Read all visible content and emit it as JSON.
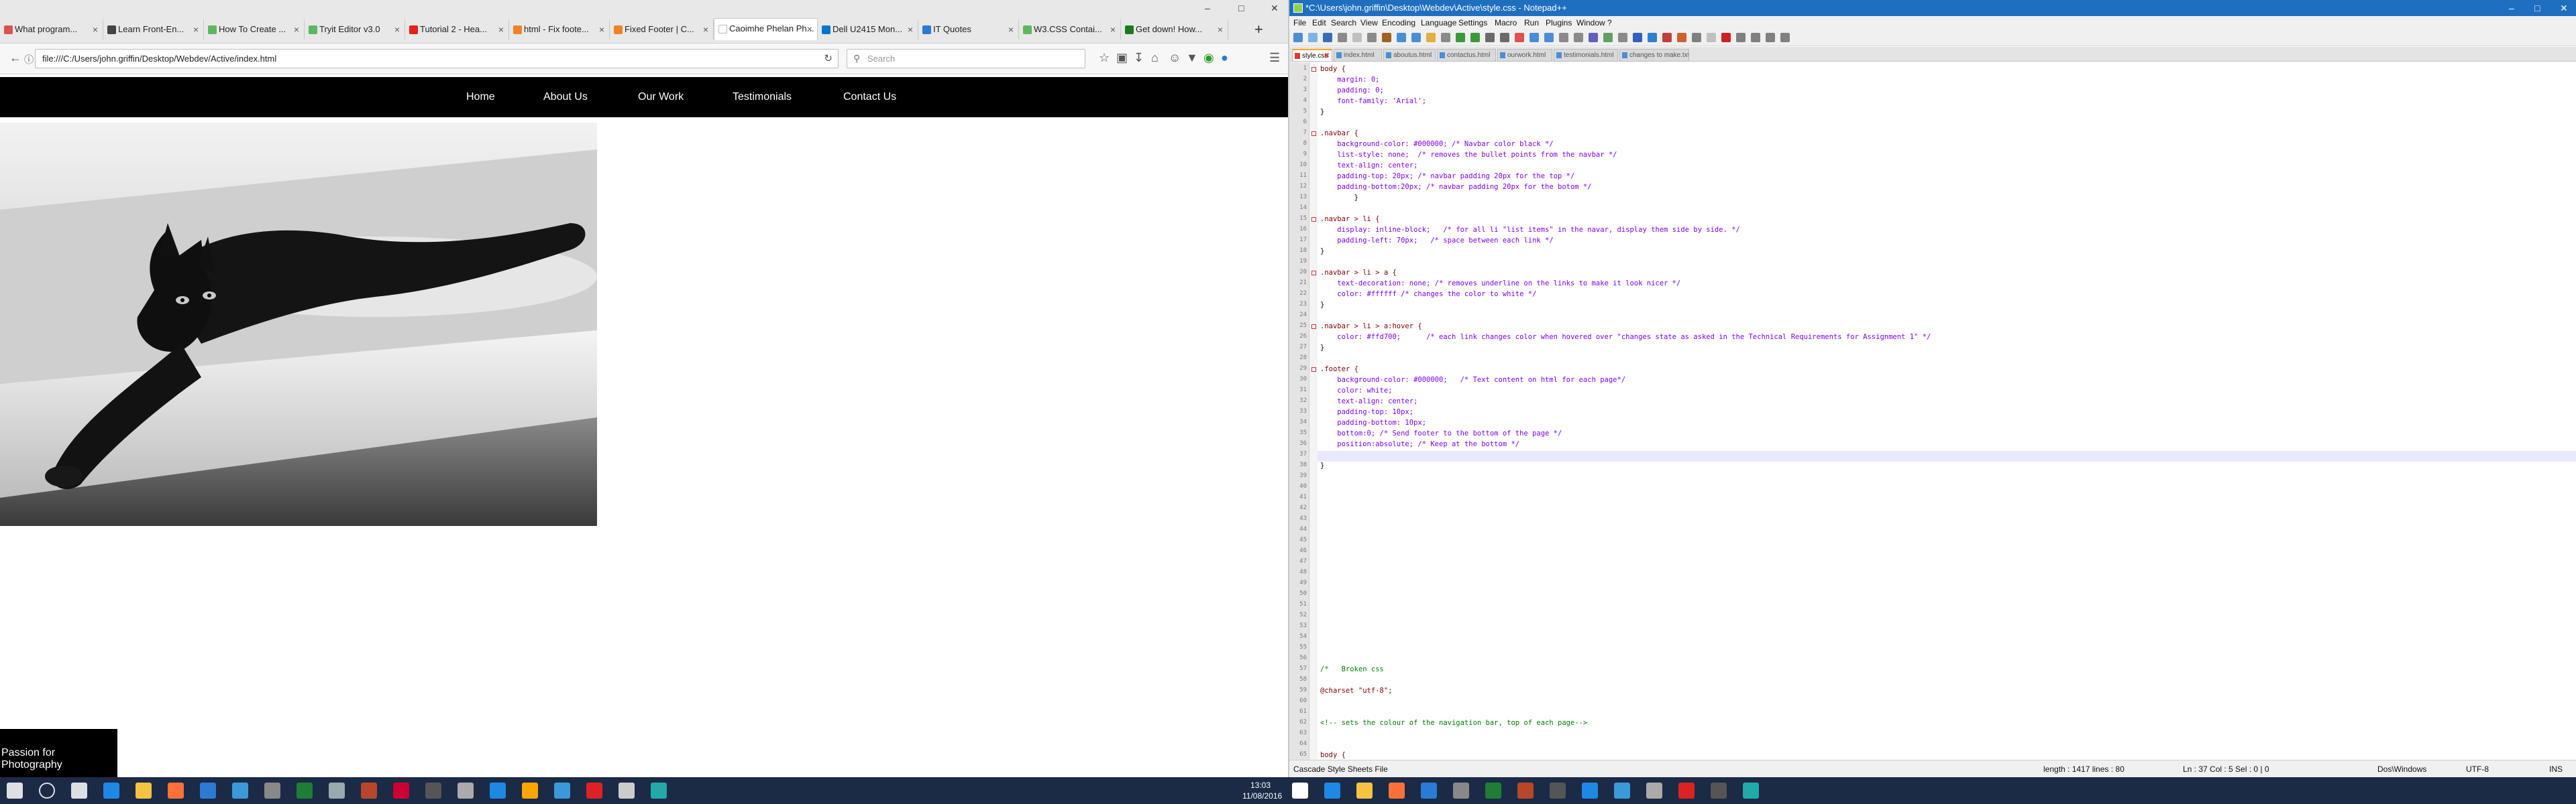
{
  "browser": {
    "tabs": [
      {
        "label": "What program...",
        "icon_color": "#d9534f"
      },
      {
        "label": "Learn Front-En...",
        "icon_color": "#444444"
      },
      {
        "label": "How To Create ...",
        "icon_color": "#5cb85c"
      },
      {
        "label": "Tryit Editor v3.0",
        "icon_color": "#5cb85c"
      },
      {
        "label": "Tutorial 2 - Hea...",
        "icon_color": "#e62117"
      },
      {
        "label": "html - Fix foote...",
        "icon_color": "#f48024"
      },
      {
        "label": "Fixed Footer | C...",
        "icon_color": "#f48024"
      },
      {
        "label": "Caoimhe Phelan Ph...",
        "icon_color": "#ffffff"
      },
      {
        "label": "Dell U2415 Mon...",
        "icon_color": "#0076ce"
      },
      {
        "label": "IT Quotes",
        "icon_color": "#2a7bd4"
      },
      {
        "label": "W3.CSS Contai...",
        "icon_color": "#5cb85c"
      },
      {
        "label": "Get down! How...",
        "icon_color": "#1a7a1a"
      }
    ],
    "url": "file:///C:/Users/john.griffin/Desktop/Webdev/Active/index.html",
    "search_placeholder": "Search"
  },
  "site": {
    "nav": [
      "Home",
      "About Us",
      "Our Work",
      "Testimonials",
      "Contact Us"
    ],
    "footer": "Passion for Photography"
  },
  "notepad": {
    "title": "*C:\\Users\\john.griffin\\Desktop\\Webdev\\Active\\style.css - Notepad++",
    "menu": [
      "File",
      "Edit",
      "Search",
      "View",
      "Encoding",
      "Language",
      "Settings",
      "Macro",
      "Run",
      "Plugins",
      "Window",
      "?"
    ],
    "tabs": [
      "style.css",
      "index.html",
      "aboutus.html",
      "contactus.html",
      "ourwork.html",
      "testimonials.html",
      "changes to make.txt"
    ],
    "lines": [
      "body {",
      "    margin: 0;",
      "    padding: 0;",
      "    font-family: 'Arial';",
      "}",
      "",
      ".navbar {",
      "    background-color: #000000; /* Navbar color black */",
      "    list-style: none;  /* removes the bullet points from the navbar */",
      "    text-align: center;",
      "    padding-top: 20px; /* navbar padding 20px for the top */",
      "    padding-bottom:20px; /* navbar padding 20px for the botom */",
      "        }",
      "",
      ".navbar > li {",
      "    display: inline-block;   /* for all li \"list items\" in the navar, display them side by side. */",
      "    padding-left: 70px;   /* space between each link */",
      "}",
      "",
      ".navbar > li > a {",
      "    text-decoration: none; /* removes underline on the links to make it look nicer */",
      "    color: #ffffff /* changes the color to white */",
      "}",
      "",
      ".navbar > li > a:hover {",
      "    color: #ffd700;      /* each link changes color when hovered over \"changes state as asked in the Technical Requirements for Assignment 1\" */",
      "}",
      "",
      ".footer {",
      "    background-color: #000000;   /* Text content on html for each page*/",
      "    color: white;",
      "    text-align: center;",
      "    padding-top: 10px;",
      "    padding-bottom: 10px;",
      "    bottom:0; /* Send footer to the bottom of the page */",
      "    position:absolute; /* Keep at the bottom */",
      "    ",
      "}",
      "",
      "",
      "",
      "",
      "",
      "",
      "",
      "",
      "",
      "",
      "",
      "",
      "",
      "",
      "",
      "",
      "",
      "",
      "/*   Broken css",
      "",
      "@charset \"utf-8\";",
      "",
      "",
      "<!-- sets the colour of the navigation bar, top of each page-->",
      "",
      "",
      "body {"
    ],
    "status": {
      "type": "Cascade Style Sheets File",
      "length": "length : 1417    lines : 80",
      "pos": "Ln : 37    Col : 5    Sel : 0 | 0",
      "eol": "Dos\\Windows",
      "enc": "UTF-8",
      "ins": "INS"
    }
  },
  "taskbar": {
    "time": "13:03",
    "date": "11/08/2016"
  }
}
